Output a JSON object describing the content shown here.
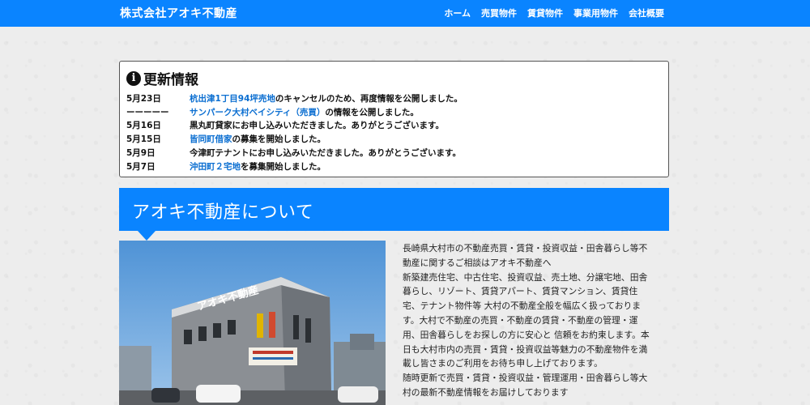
{
  "header": {
    "brand": "株式会社アオキ不動産",
    "nav": [
      "ホーム",
      "売買物件",
      "賃貸物件",
      "事業用物件",
      "会社概要"
    ]
  },
  "news": {
    "title": "更新情報",
    "items": [
      {
        "date": "5月23日",
        "link": "杭出津1丁目94坪売地",
        "text": "のキャンセルのため、再度情報を公開しました。"
      },
      {
        "date": "ーーーーー",
        "link": "サンパーク大村ベイシティ（売買）",
        "text": "の情報を公開しました。"
      },
      {
        "date": "5月16日",
        "link": "",
        "text": "黒丸町貸家にお申し込みいただきました。ありがとうございます。"
      },
      {
        "date": "5月15日",
        "link": "皆同町借家",
        "text": "の募集を開始しました。"
      },
      {
        "date": "5月9日",
        "link": "",
        "text": "今津町テナントにお申し込みいただきました。ありがとうございます。"
      },
      {
        "date": "5月7日",
        "link": "沖田町２宅地",
        "text": "を募集開始しました。"
      }
    ]
  },
  "about": {
    "title": "アオキ不動産について",
    "photo_sign": "アオキ不動産",
    "lines": [
      "長崎県大村市の不動産売買・賃貸・投資収益・田舎暮らし等不",
      "動産に関するご相談はアオキ不動産へ",
      "新築建売住宅、中古住宅、投資収益、売土地、分譲宅地、田舎",
      "暮らし、リゾート、賃貸アパート、賃貸マンション、賃貸住",
      "宅、テナント物件等 大村の不動産全般を幅広く扱っておりま",
      "す。大村で不動産の売買・不動産の賃貸・不動産の管理・運",
      "用、田舎暮らしをお探しの方に安心と 信頼をお約束します。本",
      "日も大村市内の売買・賃貸・投資収益等魅力の不動産物件を満",
      "載し皆さまのご利用をお待ち申し上げております。",
      "随時更新で売買・賃貸・投資収益・管理運用・田舎暮らし等大",
      "村の最新不動産情報をお届けしております"
    ]
  }
}
